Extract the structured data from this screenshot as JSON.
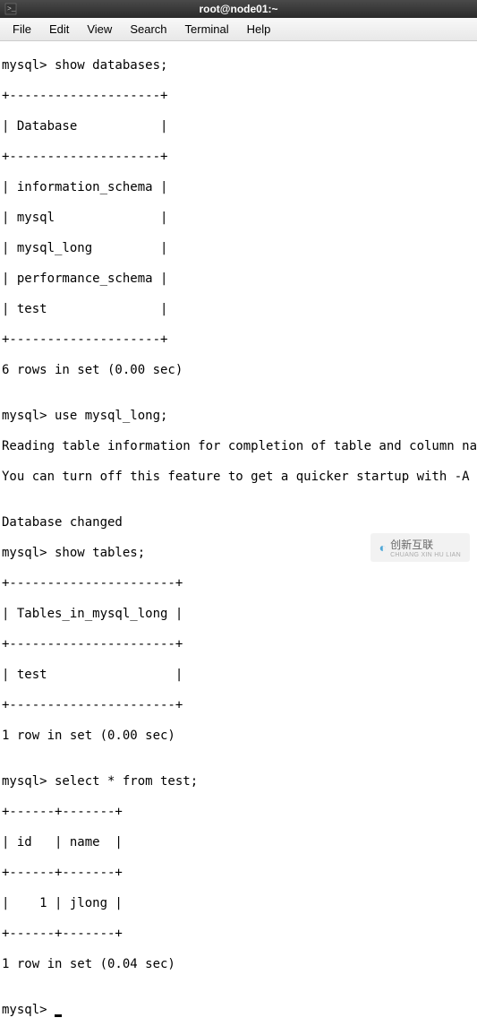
{
  "titlebar": {
    "title": "root@node01:~"
  },
  "menubar": {
    "items": [
      "File",
      "Edit",
      "View",
      "Search",
      "Terminal",
      "Help"
    ]
  },
  "terminal": {
    "lines": [
      "mysql> show databases;",
      "+--------------------+",
      "| Database           |",
      "+--------------------+",
      "| information_schema |",
      "| mysql              |",
      "| mysql_long         |",
      "| performance_schema |",
      "| test               |",
      "+--------------------+",
      "6 rows in set (0.00 sec)",
      "",
      "mysql> use mysql_long;",
      "Reading table information for completion of table and column names",
      "You can turn off this feature to get a quicker startup with -A",
      "",
      "Database changed",
      "mysql> show tables;",
      "+----------------------+",
      "| Tables_in_mysql_long |",
      "+----------------------+",
      "| test                 |",
      "+----------------------+",
      "1 row in set (0.00 sec)",
      "",
      "mysql> select * from test;",
      "+------+-------+",
      "| id   | name  |",
      "+------+-------+",
      "|    1 | jlong |",
      "+------+-------+",
      "1 row in set (0.04 sec)",
      "",
      "mysql> "
    ]
  },
  "watermark": {
    "text": "创新互联",
    "subtext": "CHUANG XIN HU LIAN"
  }
}
